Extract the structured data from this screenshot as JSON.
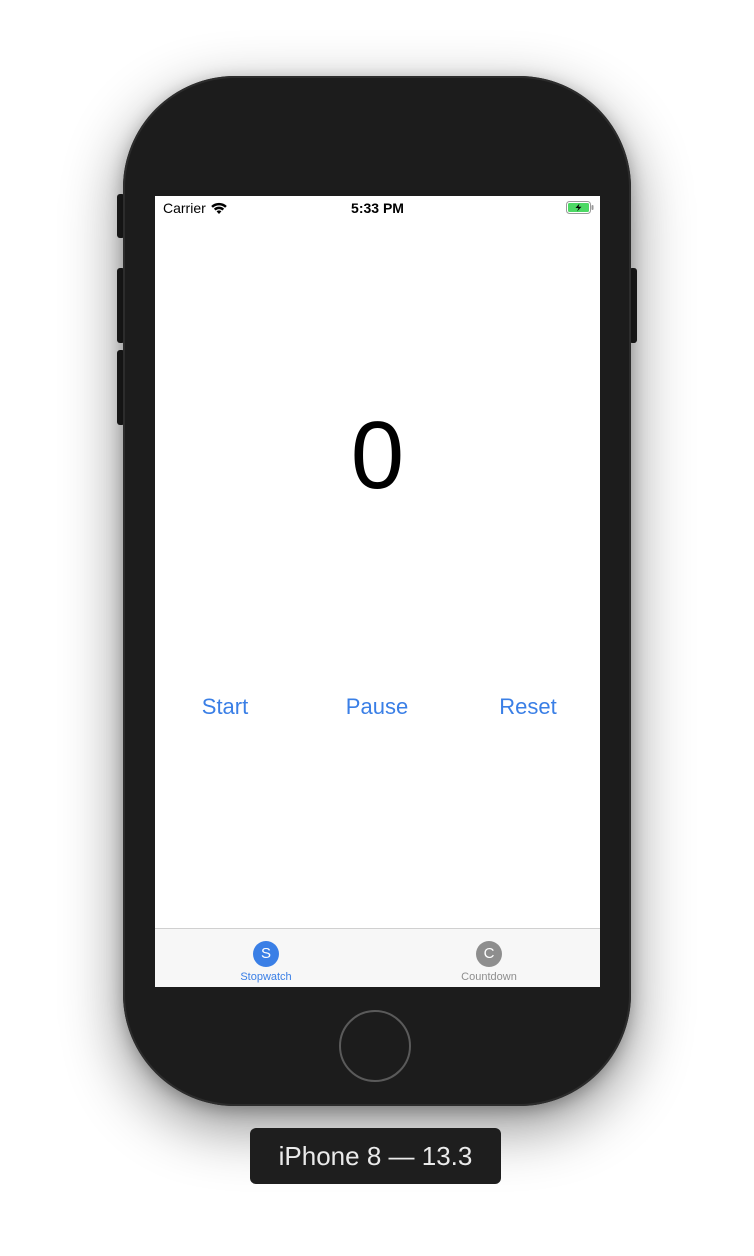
{
  "status_bar": {
    "carrier": "Carrier",
    "time": "5:33 PM",
    "wifi_icon": "wifi-icon",
    "battery_icon": "battery-charging-icon",
    "battery_color": "#4cd964"
  },
  "stopwatch": {
    "value": "0"
  },
  "controls": {
    "start_label": "Start",
    "pause_label": "Pause",
    "reset_label": "Reset",
    "accent_color": "#3a7fe6"
  },
  "tab_bar": {
    "tabs": [
      {
        "icon_letter": "S",
        "label": "Stopwatch",
        "selected": true,
        "color": "#3a7fe6"
      },
      {
        "icon_letter": "C",
        "label": "Countdown",
        "selected": false,
        "color": "#8e8e8e"
      }
    ]
  },
  "device": {
    "label": "iPhone 8 — 13.3"
  }
}
